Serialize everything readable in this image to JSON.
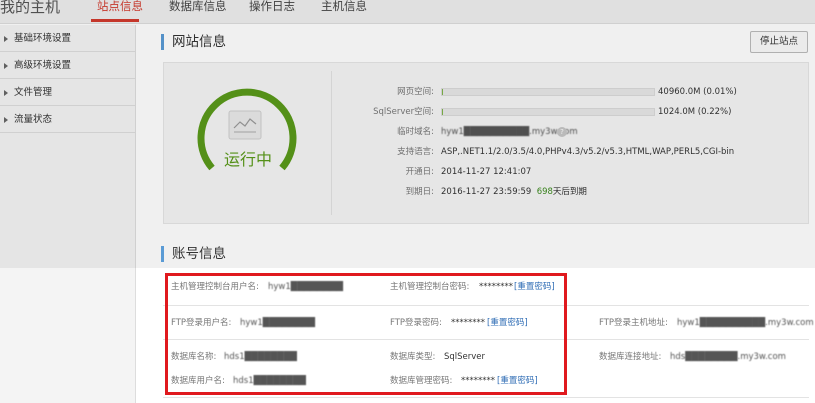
{
  "nav": {
    "brand": "我的主机",
    "tabs": [
      "站点信息",
      "数据库信息",
      "操作日志",
      "主机信息"
    ],
    "active_tab": "站点信息"
  },
  "sidebar": {
    "items": [
      {
        "label": "基础环境设置"
      },
      {
        "label": "高级环境设置"
      },
      {
        "label": "文件管理"
      },
      {
        "label": "流量状态"
      }
    ]
  },
  "site": {
    "title": "网站信息",
    "stop_button": "停止站点",
    "status": "运行中",
    "web_space_label": "网页空间:",
    "web_space_value": "40960.0M (0.01%)",
    "web_space_fraction": 0.0001,
    "sqlserver_label": "SqlServer空间:",
    "sqlserver_value": "1024.0M (0.22%)",
    "sqlserver_fraction": 0.0022,
    "temp_domain_label": "临时域名:",
    "temp_domain_value": "hyw1██████████.my3w.com",
    "support_label": "支持语言:",
    "support_value": "ASP,.NET1.1/2.0/3.5/4.0,PHPv4.3/v5.2/v5.3,HTML,WAP,PERL5,CGI-bin",
    "open_label": "开通日:",
    "open_value": "2014-11-27 12:41:07",
    "expire_label": "到期日:",
    "expire_value": "2016-11-27 23:59:59",
    "expire_days": "698",
    "expire_suffix": "天后到期"
  },
  "account": {
    "title": "账号信息",
    "host_user_label": "主机管理控制台用户名:",
    "host_user_value": "hyw1████████",
    "host_pwd_label": "主机管理控制台密码:",
    "host_pwd_value": "********",
    "reset_link": "[重置密码]",
    "ftp_user_label": "FTP登录用户名:",
    "ftp_user_value": "hyw1████████",
    "ftp_pwd_label": "FTP登录密码:",
    "ftp_pwd_value": "********",
    "ftp_addr_label": "FTP登录主机地址:",
    "ftp_addr_value": "hyw1██████████.my3w.com",
    "db_name_label": "数据库名称:",
    "db_name_value": "hds1████████",
    "db_type_label": "数据库类型:",
    "db_type_value": "SqlServer",
    "db_addr_label": "数据库连接地址:",
    "db_addr_value": "hds████████.my3w.com",
    "db_user_label": "数据库用户名:",
    "db_user_value": "hds1████████",
    "db_pwd_label": "数据库管理密码:",
    "db_pwd_value": "********"
  },
  "colors": {
    "accent_red": "#d23b2e",
    "gauge_green": "#5a9a1a",
    "link_blue": "#2f6db5",
    "highlight_red": "#e0191e"
  }
}
